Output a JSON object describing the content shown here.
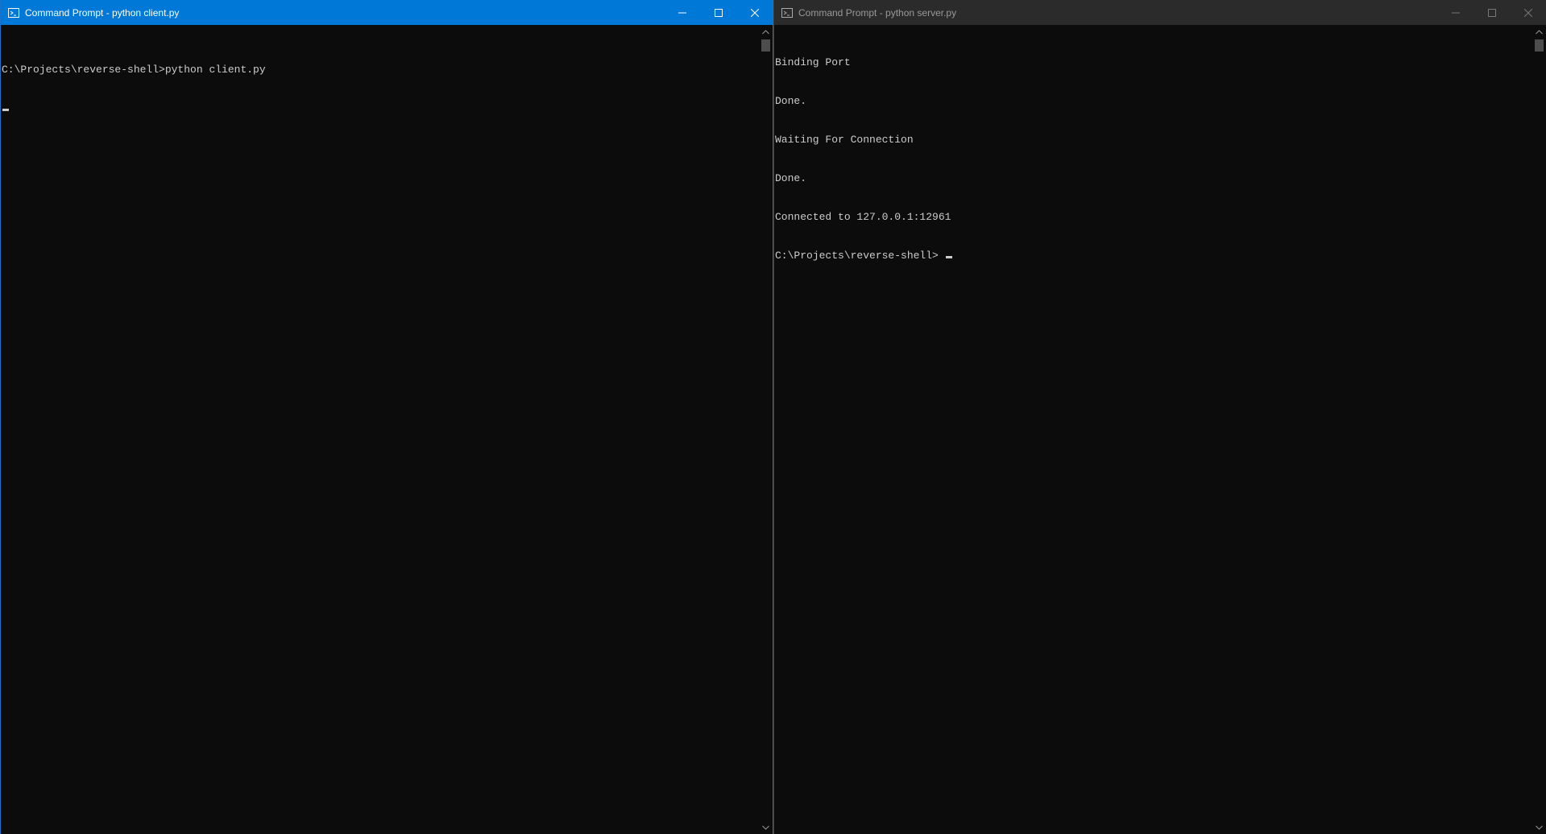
{
  "client_window": {
    "title": "Command Prompt - python  client.py",
    "icon": "command-prompt-icon",
    "active": true,
    "accent_color": "#0078d7",
    "console_lines": [
      "C:\\Projects\\reverse-shell>python client.py",
      ""
    ]
  },
  "server_window": {
    "title": "Command Prompt - python  server.py",
    "icon": "command-prompt-icon",
    "active": false,
    "console_lines": [
      "Binding Port",
      "Done.",
      "Waiting For Connection",
      "Done.",
      "Connected to 127.0.0.1:12961",
      "C:\\Projects\\reverse-shell> "
    ]
  },
  "caption_buttons": [
    "minimize-icon",
    "maximize-icon",
    "close-icon"
  ]
}
